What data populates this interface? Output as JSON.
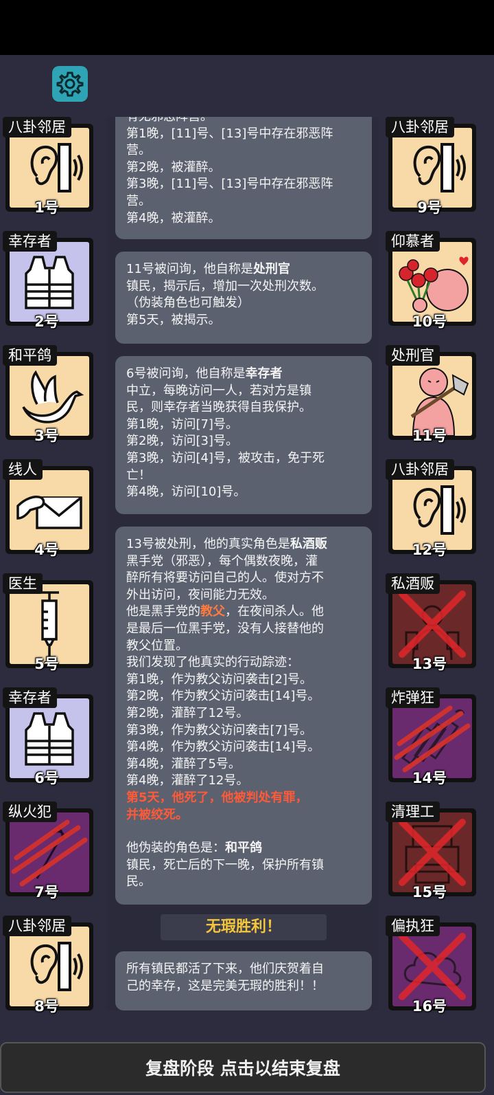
{
  "settings_icon": "gear-icon",
  "left_players": [
    {
      "role": "八卦邻居",
      "number": "1号",
      "icon": "ear-icon",
      "bg": "tan",
      "dead": false
    },
    {
      "role": "幸存者",
      "number": "2号",
      "icon": "vest-icon",
      "bg": "lavender",
      "dead": false
    },
    {
      "role": "和平鸽",
      "number": "3号",
      "icon": "dove-icon",
      "bg": "tan",
      "dead": false
    },
    {
      "role": "线人",
      "number": "4号",
      "icon": "envelope-icon",
      "bg": "tan",
      "dead": false
    },
    {
      "role": "医生",
      "number": "5号",
      "icon": "syringe-icon",
      "bg": "tan",
      "dead": false
    },
    {
      "role": "幸存者",
      "number": "6号",
      "icon": "vest-icon",
      "bg": "lavender",
      "dead": false
    },
    {
      "role": "纵火犯",
      "number": "7号",
      "icon": "torch-icon",
      "bg": "purple",
      "dead": false
    },
    {
      "role": "八卦邻居",
      "number": "8号",
      "icon": "ear-icon",
      "bg": "tan",
      "dead": false
    }
  ],
  "right_players": [
    {
      "role": "八卦邻居",
      "number": "9号",
      "icon": "ear-icon",
      "bg": "tan",
      "dead": false
    },
    {
      "role": "仰慕者",
      "number": "10号",
      "icon": "admirer-roses-icon",
      "bg": "tan",
      "dead": false
    },
    {
      "role": "处刑官",
      "number": "11号",
      "icon": "executioner-axe-icon",
      "bg": "tan",
      "dead": false
    },
    {
      "role": "八卦邻居",
      "number": "12号",
      "icon": "ear-icon",
      "bg": "tan",
      "dead": false
    },
    {
      "role": "私酒贩",
      "number": "13号",
      "icon": "bootlegger-icon",
      "bg": "red",
      "dead": true
    },
    {
      "role": "炸弹狂",
      "number": "14号",
      "icon": "dynamite-icon",
      "bg": "purple",
      "dead": false
    },
    {
      "role": "清理工",
      "number": "15号",
      "icon": "printer-icon",
      "bg": "red",
      "dead": true
    },
    {
      "role": "偏执狂",
      "number": "16号",
      "icon": "cloud-icon",
      "bg": "purple",
      "dead": true
    }
  ],
  "messages": {
    "m1": {
      "line0": "有无邪恶阵营。",
      "line1": "第1晚，[11]号、[13]号中存在邪恶阵",
      "line2": "营。",
      "line3": "第2晚，被灌醉。",
      "line4": "第3晚，[11]号、[13]号中存在邪恶阵",
      "line5": "营。",
      "line6": "第4晚，被灌醉。"
    },
    "m2": {
      "line1_pre": "11号被问询，他自称是",
      "line1_role": "处刑官",
      "line2": "镇民，揭示后，增加一次处刑次数。",
      "line3": "（伪装角色也可触发）",
      "line4": "第5天，被揭示。"
    },
    "m3": {
      "line1_pre": "6号被问询，他自称是",
      "line1_role": "幸存者",
      "line2": "中立，每晚访问一人，若对方是镇",
      "line3": "民，则幸存者当晚获得自我保护。",
      "line4": "第1晚，访问[7]号。",
      "line5": "第2晚，访问[3]号。",
      "line6": "第3晚，访问[4]号，被攻击，免于死",
      "line7": "亡！",
      "line8": "第4晚，访问[10]号。"
    },
    "m4": {
      "line1_pre": "13号被处刑，他的真实角色是",
      "line1_role": "私酒贩",
      "line2": "黑手党（邪恶），每个偶数夜晚，灌",
      "line3": "醉所有将要访问自己的人。使对方不",
      "line4": "外出访问，夜间能力无效。",
      "line5_pre": "他是黑手党的",
      "line5_role": "教父",
      "line5_post": "，在夜间杀人。他",
      "line6": "是最后一位黑手党，没有人接替他的",
      "line7": "教父位置。",
      "line8": "我们发现了他真实的行动踪迹：",
      "line9": "第1晚，作为教父访问袭击[2]号。",
      "line10": "第2晚，作为教父访问袭击[14]号。",
      "line11": "第2晚，灌醉了12号。",
      "line12": "第3晚，作为教父访问袭击[7]号。",
      "line13": "第4晚，作为教父访问袭击[14]号。",
      "line14": "第4晚，灌醉了5号。",
      "line15": "第4晚，灌醉了12号。",
      "line16": "第5天，他死了，他被判处有罪，",
      "line17": "并被绞死。",
      "line18_pre": "他伪装的角色是：",
      "line18_role": "和平鸽",
      "line19": "镇民，死亡后的下一晚，保护所有镇",
      "line20": "民。"
    },
    "victory": "无瑕胜利！",
    "m5": {
      "line1": "所有镇民都活了下来，他们庆贺着自",
      "line2": "己的幸存，这是完美无瑕的胜利！！"
    }
  },
  "bottom_bar": "复盘阶段 点击以结束复盘",
  "colors": {
    "tan": "#f8d9a8",
    "lavender": "#c5c3ec",
    "purple": "#6a2a6e",
    "red": "#6b2828",
    "accent_orange": "#ff7a3c",
    "victory_gold": "#f5c63a",
    "gear": "#2fa4b4"
  }
}
